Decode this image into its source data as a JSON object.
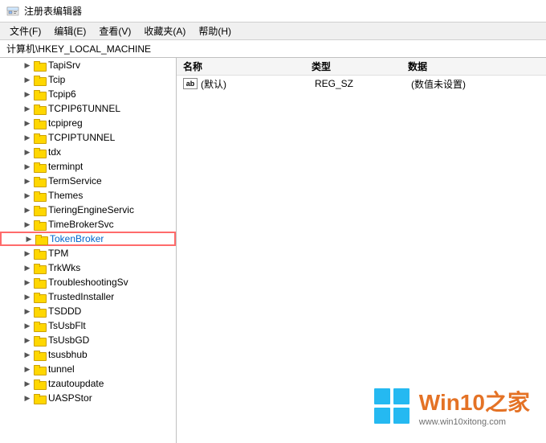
{
  "titleBar": {
    "icon": "regedit-icon",
    "title": "注册表编辑器"
  },
  "menuBar": {
    "items": [
      {
        "id": "file",
        "label": "文件(F)"
      },
      {
        "id": "edit",
        "label": "编辑(E)"
      },
      {
        "id": "view",
        "label": "查看(V)"
      },
      {
        "id": "favorites",
        "label": "收藏夹(A)"
      },
      {
        "id": "help",
        "label": "帮助(H)"
      }
    ]
  },
  "addressBar": {
    "path": "计算机\\HKEY_LOCAL_MACHINE"
  },
  "treePane": {
    "items": [
      {
        "id": "tapisrv",
        "label": "TapiSrv",
        "expanded": false,
        "indent": 1
      },
      {
        "id": "tcip",
        "label": "Tcip",
        "expanded": false,
        "indent": 1
      },
      {
        "id": "tcpip6",
        "label": "Tcpip6",
        "expanded": false,
        "indent": 1
      },
      {
        "id": "tcpip6tunnel",
        "label": "TCPIP6TUNNEL",
        "expanded": false,
        "indent": 1
      },
      {
        "id": "tcpipreg",
        "label": "tcpipreg",
        "expanded": false,
        "indent": 1
      },
      {
        "id": "tcpiptunnel",
        "label": "TCPIPTUNNEL",
        "expanded": false,
        "indent": 1
      },
      {
        "id": "tdx",
        "label": "tdx",
        "expanded": false,
        "indent": 1
      },
      {
        "id": "terminpt",
        "label": "terminpt",
        "expanded": false,
        "indent": 1
      },
      {
        "id": "termservice",
        "label": "TermService",
        "expanded": false,
        "indent": 1
      },
      {
        "id": "themes",
        "label": "Themes",
        "expanded": false,
        "indent": 1
      },
      {
        "id": "tieringengineservice",
        "label": "TieringEngineServic",
        "expanded": false,
        "indent": 1
      },
      {
        "id": "timebrokersvc",
        "label": "TimeBrokerSvc",
        "expanded": false,
        "indent": 1
      },
      {
        "id": "tokenbroker",
        "label": "TokenBroker",
        "expanded": false,
        "indent": 1,
        "highlighted": true
      },
      {
        "id": "tpm",
        "label": "TPM",
        "expanded": false,
        "indent": 1
      },
      {
        "id": "trkwks",
        "label": "TrkWks",
        "expanded": false,
        "indent": 1
      },
      {
        "id": "troubleshootingsv",
        "label": "TroubleshootingSv",
        "expanded": false,
        "indent": 1
      },
      {
        "id": "trustedinstaller",
        "label": "TrustedInstaller",
        "expanded": false,
        "indent": 1
      },
      {
        "id": "tsddd",
        "label": "TSDDD",
        "expanded": false,
        "indent": 1
      },
      {
        "id": "tsusbflt",
        "label": "TsUsbFlt",
        "expanded": false,
        "indent": 1
      },
      {
        "id": "tsusbgd",
        "label": "TsUsbGD",
        "expanded": false,
        "indent": 1
      },
      {
        "id": "tsusbhub",
        "label": "tsusbhub",
        "expanded": false,
        "indent": 1
      },
      {
        "id": "tunnel",
        "label": "tunnel",
        "expanded": false,
        "indent": 1
      },
      {
        "id": "tzautoupdate",
        "label": "tzautoupdate",
        "expanded": false,
        "indent": 1
      },
      {
        "id": "uaspstor",
        "label": "UASPStor",
        "expanded": false,
        "indent": 1
      }
    ]
  },
  "detailPane": {
    "columns": {
      "name": "名称",
      "type": "类型",
      "data": "数据"
    },
    "rows": [
      {
        "icon": "ab",
        "name": "(默认)",
        "type": "REG_SZ",
        "data": "(数值未设置)"
      }
    ]
  },
  "watermark": {
    "title_part1": "Win10",
    "title_part2": "之家",
    "url": "www.win10xitong.com"
  }
}
